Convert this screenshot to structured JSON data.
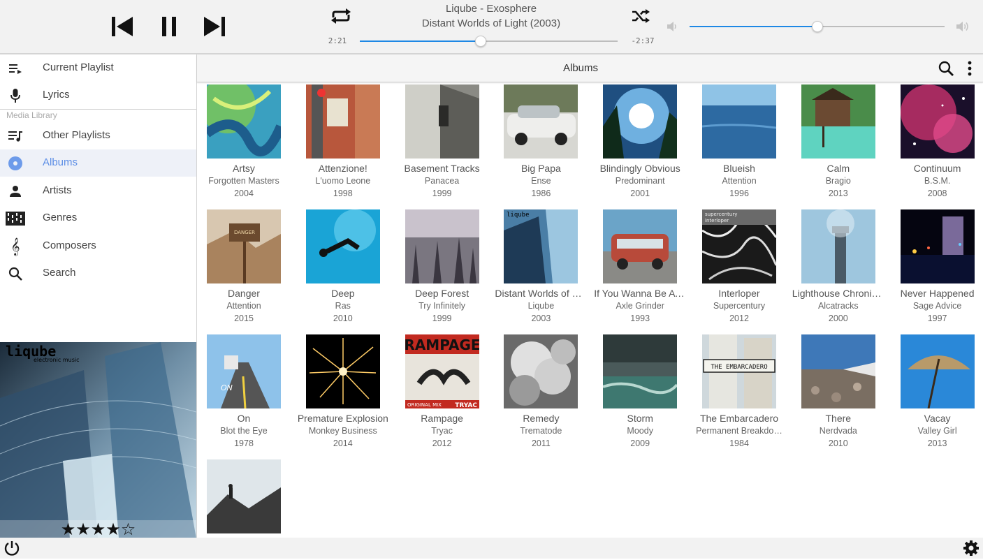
{
  "player": {
    "track_title": "Liqube - Exosphere",
    "track_album": "Distant Worlds of Light (2003)",
    "time_elapsed": "2:21",
    "time_remaining": "-2:37",
    "seek_fraction": 0.47,
    "volume_fraction": 0.5,
    "accent_color": "#1e88e5"
  },
  "nav": {
    "current_playlist": "Current Playlist",
    "lyrics": "Lyrics",
    "section_label": "Media Library",
    "other_playlists": "Other Playlists",
    "albums": "Albums",
    "artists": "Artists",
    "genres": "Genres",
    "composers": "Composers",
    "search": "Search",
    "active_color": "#5c8ee6"
  },
  "now_playing": {
    "cover_text": "liqube",
    "cover_subtext": "electronic music",
    "rating": 4,
    "rating_max": 5
  },
  "main": {
    "title": "Albums"
  },
  "albums": [
    {
      "title": "Artsy",
      "artist": "Forgotten Masters",
      "year": "2004"
    },
    {
      "title": "Attenzione!",
      "artist": "L'uomo Leone",
      "year": "1998"
    },
    {
      "title": "Basement Tracks",
      "artist": "Panacea",
      "year": "1999"
    },
    {
      "title": "Big Papa",
      "artist": "Ense",
      "year": "1986"
    },
    {
      "title": "Blindingly Obvious",
      "artist": "Predominant",
      "year": "2001"
    },
    {
      "title": "Blueish",
      "artist": "Attention",
      "year": "1996"
    },
    {
      "title": "Calm",
      "artist": "Bragio",
      "year": "2013"
    },
    {
      "title": "Continuum",
      "artist": "B.S.M.",
      "year": "2008"
    },
    {
      "title": "Danger",
      "artist": "Attention",
      "year": "2015"
    },
    {
      "title": "Deep",
      "artist": "Ras",
      "year": "2010"
    },
    {
      "title": "Deep Forest",
      "artist": "Try Infinitely",
      "year": "1999"
    },
    {
      "title": "Distant Worlds of Li…",
      "artist": "Liqube",
      "year": "2003"
    },
    {
      "title": "If You Wanna Be A …",
      "artist": "Axle Grinder",
      "year": "1993"
    },
    {
      "title": "Interloper",
      "artist": "Supercentury",
      "year": "2012"
    },
    {
      "title": "Lighthouse Chronic…",
      "artist": "Alcatracks",
      "year": "2000"
    },
    {
      "title": "Never Happened",
      "artist": "Sage Advice",
      "year": "1997"
    },
    {
      "title": "On",
      "artist": "Blot the Eye",
      "year": "1978"
    },
    {
      "title": "Premature Explosion",
      "artist": "Monkey Business",
      "year": "2014"
    },
    {
      "title": "Rampage",
      "artist": "Tryac",
      "year": "2012"
    },
    {
      "title": "Remedy",
      "artist": "Trematode",
      "year": "2011"
    },
    {
      "title": "Storm",
      "artist": "Moody",
      "year": "2009"
    },
    {
      "title": "The Embarcadero",
      "artist": "Permanent Breakdo…",
      "year": "1984"
    },
    {
      "title": "There",
      "artist": "Nerdvada",
      "year": "2010"
    },
    {
      "title": "Vacay",
      "artist": "Valley Girl",
      "year": "2013"
    },
    {
      "title": "",
      "artist": "",
      "year": ""
    }
  ],
  "cover_texts": {
    "danger_sign": "DANGER",
    "distant_label": "liqube",
    "interloper_label": "supercentury",
    "interloper_sub": "interloper",
    "on_text": "ON",
    "rampage_title": "RAMPAGE",
    "rampage_left": "ORIGINAL MIX",
    "rampage_right": "TRYAC",
    "embarcadero_sign": "THE EMBARCADERO"
  }
}
